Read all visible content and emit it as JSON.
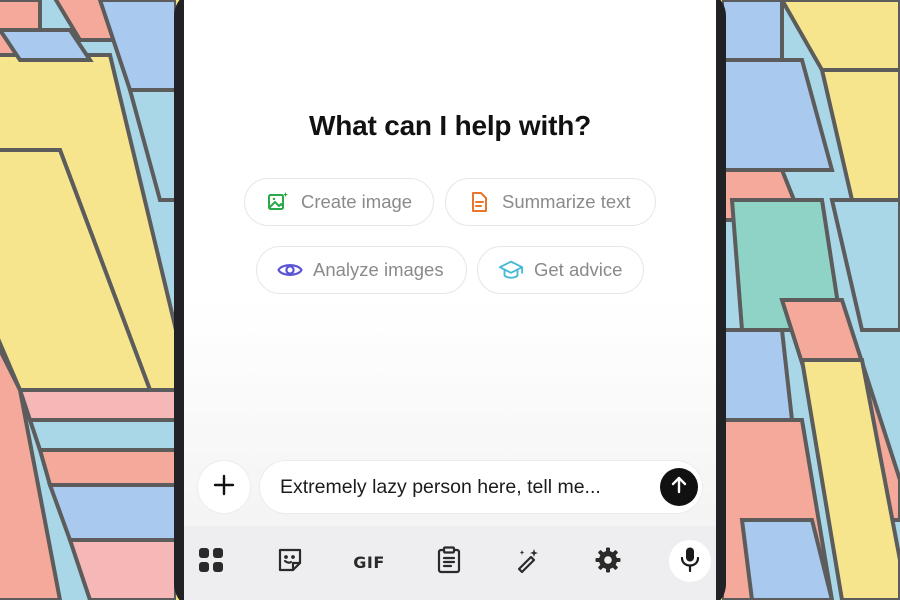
{
  "colors": {
    "heading": "#111111",
    "chip_text": "#8a8a8a",
    "create_icon": "#2aa84a",
    "summarize_icon": "#e8762d",
    "analyze_icon": "#5b53d6",
    "advice_icon": "#46b9d6",
    "send_button": "#111111",
    "keyboard_bar": "#eeeef0"
  },
  "heading": "What can I help with?",
  "suggestions": [
    {
      "label": "Create image",
      "icon": "image-sparkle-icon"
    },
    {
      "label": "Summarize text",
      "icon": "document-icon"
    },
    {
      "label": "Analyze images",
      "icon": "eye-icon"
    },
    {
      "label": "Get advice",
      "icon": "graduation-cap-icon"
    }
  ],
  "composer": {
    "input_text": "Extremely lazy person here, tell me...",
    "plus_icon": "plus-icon",
    "send_icon": "arrow-up-icon"
  },
  "keyboard_toolbar": {
    "gif_label": "GIF",
    "items": [
      "apps-grid-icon",
      "sticker-icon",
      "gif-icon",
      "clipboard-icon",
      "magic-wand-icon",
      "gear-icon",
      "microphone-icon"
    ]
  }
}
